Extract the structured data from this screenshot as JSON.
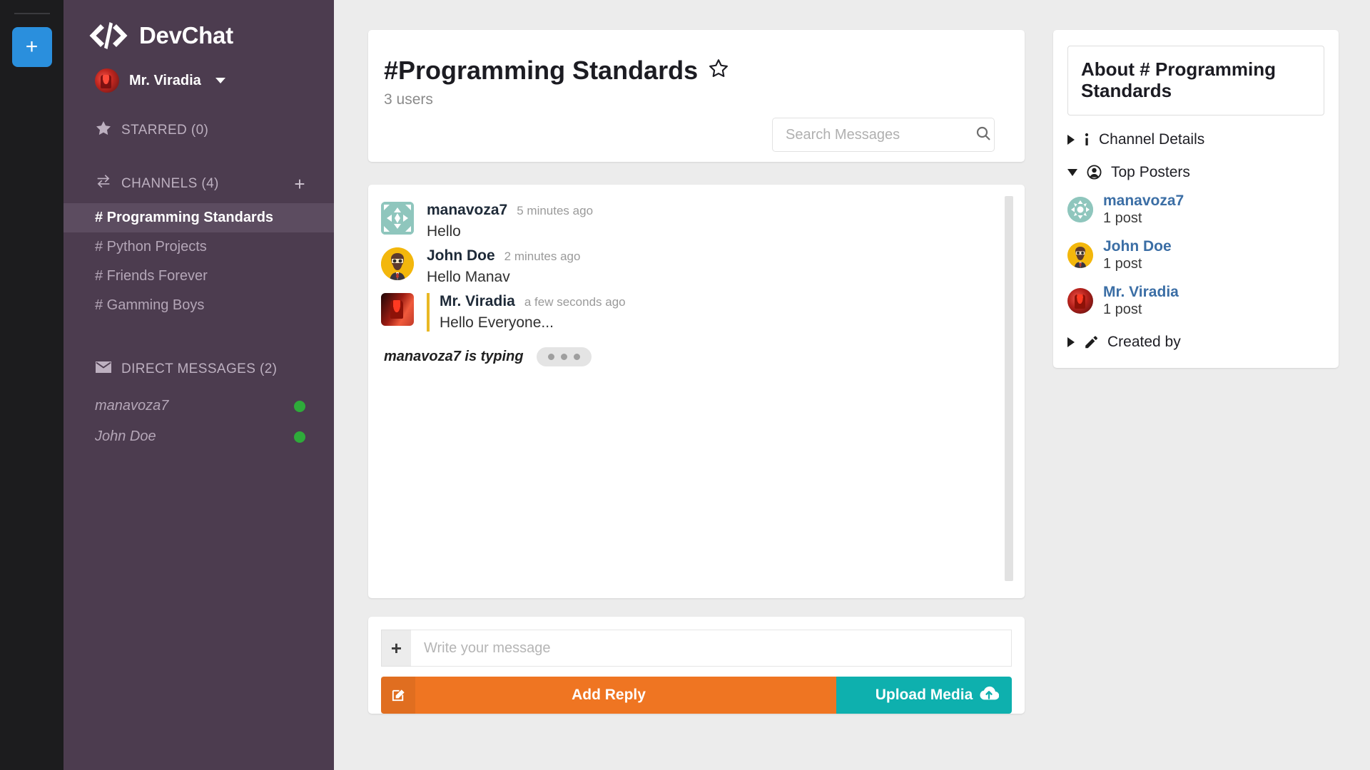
{
  "rail": {
    "add_label": "+",
    "add_icon": "plus-icon"
  },
  "sidebar": {
    "brand": {
      "name": "DevChat",
      "icon": "code-brackets-icon"
    },
    "user": {
      "name": "Mr. Viradia",
      "avatar_icon": "user-avatar",
      "caret_icon": "chevron-down-icon"
    },
    "starred": {
      "label": "STARRED (0)",
      "icon": "star-icon"
    },
    "channels_header": {
      "label": "CHANNELS (4)",
      "icon": "exchange-arrows-icon",
      "add_icon": "plus-icon",
      "add_label": "+"
    },
    "channels": [
      {
        "label": "# Programming Standards",
        "active": true
      },
      {
        "label": "# Python Projects",
        "active": false
      },
      {
        "label": "# Friends Forever",
        "active": false
      },
      {
        "label": "# Gamming Boys",
        "active": false
      }
    ],
    "dm_header": {
      "label": "DIRECT MESSAGES (2)",
      "icon": "envelope-icon"
    },
    "direct_messages": [
      {
        "name": "manavoza7",
        "status": "online"
      },
      {
        "name": "John Doe",
        "status": "online"
      }
    ]
  },
  "channel_header": {
    "title": "#Programming Standards",
    "star_icon": "star-outline-icon",
    "users": "3 users",
    "search": {
      "placeholder": "Search Messages",
      "value": "",
      "icon": "search-icon"
    }
  },
  "messages": [
    {
      "author": "manavoza7",
      "time": "5 minutes ago",
      "text": "Hello",
      "own": false,
      "avatar": "identicon-teal"
    },
    {
      "author": "John Doe",
      "time": "2 minutes ago",
      "text": "Hello Manav",
      "own": false,
      "avatar": "avatar-john"
    },
    {
      "author": "Mr. Viradia",
      "time": "a few seconds ago",
      "text": "Hello Everyone...",
      "own": true,
      "avatar": "avatar-viradia"
    }
  ],
  "typing": {
    "text": "manavoza7 is typing",
    "dots": 3
  },
  "composer": {
    "attach_label": "+",
    "attach_icon": "plus-icon",
    "input_placeholder": "Write your message",
    "input_value": "",
    "reply_button": {
      "label": "Add Reply",
      "icon": "pencil-square-icon",
      "color": "#ef7522"
    },
    "upload_button": {
      "label": "Upload Media",
      "icon": "cloud-upload-icon",
      "color": "#0eb0ae"
    }
  },
  "about_panel": {
    "title": "About # Programming Standards",
    "sections": [
      {
        "label": "Channel Details",
        "icon": "info-icon",
        "expanded": false
      },
      {
        "label": "Top Posters",
        "icon": "user-circle-icon",
        "expanded": true
      },
      {
        "label": "Created by",
        "icon": "pencil-icon",
        "expanded": false
      }
    ],
    "top_posters": [
      {
        "name": "manavoza7",
        "posts": "1 post",
        "avatar": "identicon-teal"
      },
      {
        "name": "John Doe",
        "posts": "1 post",
        "avatar": "avatar-john"
      },
      {
        "name": "Mr. Viradia",
        "posts": "1 post",
        "avatar": "avatar-viradia"
      }
    ]
  },
  "colors": {
    "sidebar_bg": "#4c3c4f",
    "rail_bg": "#1c1c1e",
    "accent_blue": "#2a8fdd",
    "orange": "#ef7522",
    "teal": "#0eb0ae",
    "link_blue": "#3b6ea5",
    "online_green": "#2eab3a",
    "own_message_bar": "#e9b824"
  }
}
